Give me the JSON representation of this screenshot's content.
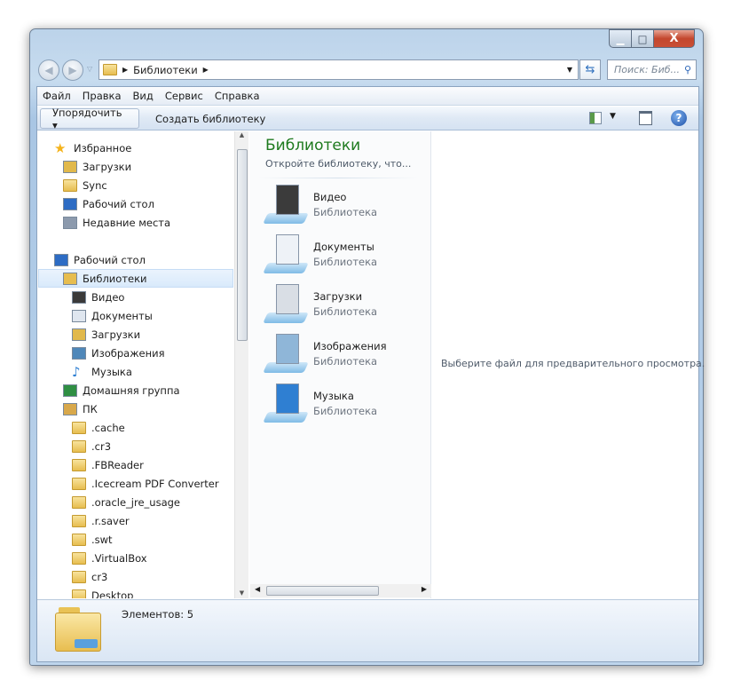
{
  "window": {
    "controls": {
      "minimize": "▁",
      "maximize": "□",
      "close": "X"
    }
  },
  "address": {
    "path": "Библиотеки",
    "search_placeholder": "Поиск: Биб..."
  },
  "menu": [
    "Файл",
    "Правка",
    "Вид",
    "Сервис",
    "Справка"
  ],
  "toolbar": {
    "organize": "Упорядочить ▾",
    "new_library": "Создать библиотеку"
  },
  "tree": [
    {
      "label": "Избранное",
      "level": 0,
      "icon": "star-icon"
    },
    {
      "label": "Загрузки",
      "level": 1,
      "icon": "downloads-icon"
    },
    {
      "label": "Sync",
      "level": 1,
      "icon": "folder-icon"
    },
    {
      "label": "Рабочий стол",
      "level": 1,
      "icon": "desktop-icon"
    },
    {
      "label": "Недавние места",
      "level": 1,
      "icon": "recent-places-icon"
    },
    {
      "label": "Рабочий стол",
      "level": 0,
      "icon": "desktop-icon",
      "gap": true
    },
    {
      "label": "Библиотеки",
      "level": 1,
      "icon": "libraries-icon",
      "selected": true
    },
    {
      "label": "Видео",
      "level": 2,
      "icon": "video-icon"
    },
    {
      "label": "Документы",
      "level": 2,
      "icon": "documents-icon"
    },
    {
      "label": "Загрузки",
      "level": 2,
      "icon": "downloads-icon"
    },
    {
      "label": "Изображения",
      "level": 2,
      "icon": "pictures-icon"
    },
    {
      "label": "Музыка",
      "level": 2,
      "icon": "music-icon"
    },
    {
      "label": "Домашняя группа",
      "level": 1,
      "icon": "homegroup-icon"
    },
    {
      "label": "ПК",
      "level": 1,
      "icon": "user-folder-icon"
    },
    {
      "label": ".cache",
      "level": 2,
      "icon": "folder-icon"
    },
    {
      "label": ".cr3",
      "level": 2,
      "icon": "folder-icon"
    },
    {
      "label": ".FBReader",
      "level": 2,
      "icon": "folder-icon"
    },
    {
      "label": ".Icecream PDF Converter",
      "level": 2,
      "icon": "folder-icon"
    },
    {
      "label": ".oracle_jre_usage",
      "level": 2,
      "icon": "folder-icon"
    },
    {
      "label": ".r.saver",
      "level": 2,
      "icon": "folder-icon"
    },
    {
      "label": ".swt",
      "level": 2,
      "icon": "folder-icon"
    },
    {
      "label": ".VirtualBox",
      "level": 2,
      "icon": "folder-icon"
    },
    {
      "label": "cr3",
      "level": 2,
      "icon": "folder-icon"
    },
    {
      "label": "Desktop",
      "level": 2,
      "icon": "folder-icon"
    }
  ],
  "libraries": {
    "title": "Библиотеки",
    "subtitle": "Откройте библиотеку, что...",
    "items": [
      {
        "name": "Видео",
        "type": "Библиотека",
        "icon": "video-library-icon"
      },
      {
        "name": "Документы",
        "type": "Библиотека",
        "icon": "documents-library-icon"
      },
      {
        "name": "Загрузки",
        "type": "Библиотека",
        "icon": "downloads-library-icon"
      },
      {
        "name": "Изображения",
        "type": "Библиотека",
        "icon": "pictures-library-icon"
      },
      {
        "name": "Музыка",
        "type": "Библиотека",
        "icon": "music-library-icon"
      }
    ]
  },
  "preview": {
    "message": "Выберите файл для предварительного просмотра."
  },
  "details": {
    "count": "Элементов: 5"
  }
}
